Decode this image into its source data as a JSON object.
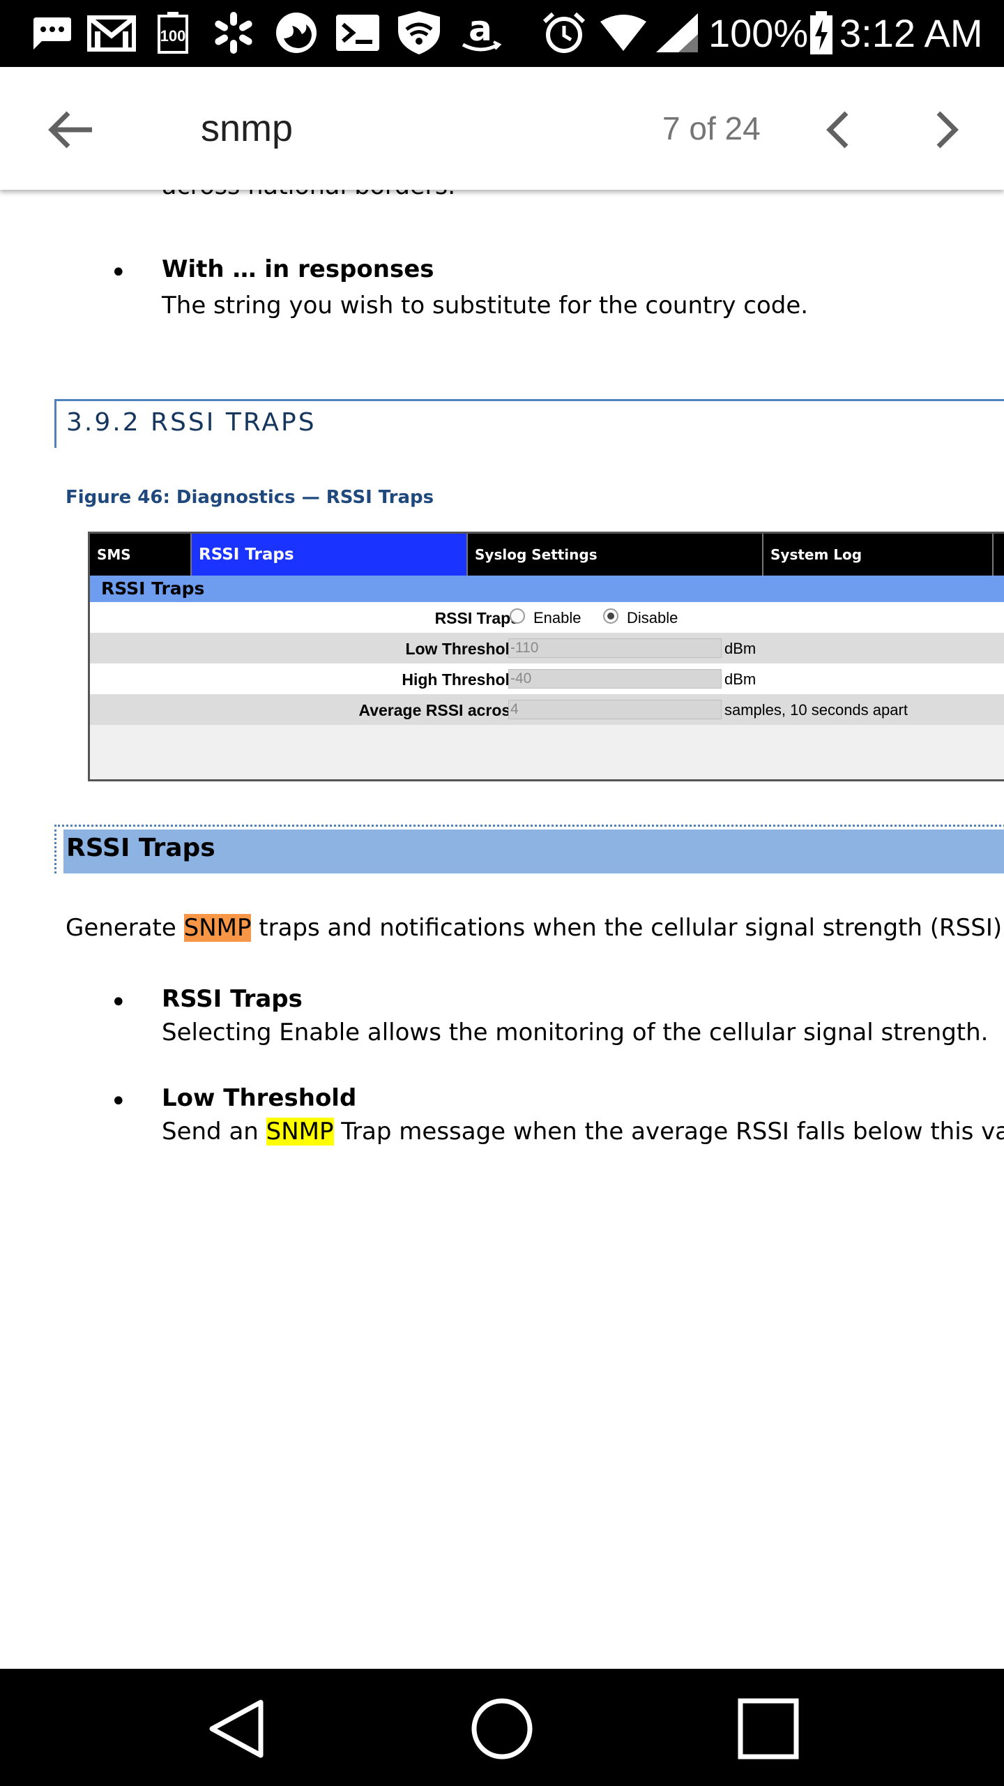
{
  "status_bar": {
    "icons": [
      "chat-more-icon",
      "gmail-icon",
      "battery-100-notification-icon",
      "walmart-spark-icon",
      "firefox-icon",
      "terminal-icon",
      "vpn-shield-wifi-icon",
      "amazon-icon",
      "alarm-clock-icon",
      "wifi-icon",
      "cell-signal-icon",
      "battery-charging-icon"
    ],
    "battery_notification_label": "100",
    "battery_percent": "100%",
    "time": "3:12 AM"
  },
  "find_bar": {
    "query": "snmp",
    "match_count": "7 of 24",
    "icons": [
      "back-arrow-icon",
      "chevron-left-icon",
      "chevron-right-icon"
    ]
  },
  "document": {
    "cut_off_text": "across national borders.",
    "bullet_with": {
      "title": "With … in responses",
      "body": "The string you wish to substitute for the country code."
    },
    "section_heading": "3.9.2   RSSI TRAPS",
    "figure_caption": "Figure 46: Diagnostics — RSSI Traps",
    "figure": {
      "tabs": [
        "SMS",
        "RSSI Traps",
        "Syslog Settings",
        "System Log"
      ],
      "active_tab": "RSSI Traps",
      "subheading": "RSSI Traps",
      "rows": {
        "rssi_traps": {
          "label": "RSSI Traps",
          "enable": "Enable",
          "disable": "Disable",
          "selected": "Disable"
        },
        "low_threshold": {
          "label": "Low Threshold",
          "value": "-110",
          "unit": "dBm"
        },
        "high_threshold": {
          "label": "High Threshold",
          "value": "-40",
          "unit": "dBm"
        },
        "average": {
          "label": "Average RSSI across",
          "value": "4",
          "unit": "samples, 10 seconds apart"
        }
      }
    },
    "traps_heading": "RSSI Traps",
    "paragraph": {
      "before": "Generate ",
      "highlight": "SNMP",
      "after": " traps and notifications when the cellular signal strength (RSSI) falls out"
    },
    "bullet_rssi": {
      "title": "RSSI Traps",
      "body": "Selecting Enable allows the monitoring of the cellular signal strength."
    },
    "bullet_low": {
      "title": "Low Threshold",
      "body_before": "Send an ",
      "highlight": "SNMP",
      "body_after": " Trap message when the average RSSI falls below this value."
    },
    "bullet_mark": "•"
  },
  "nav_bar": {
    "icons": [
      "nav-back-icon",
      "nav-home-icon",
      "nav-recents-icon"
    ]
  }
}
